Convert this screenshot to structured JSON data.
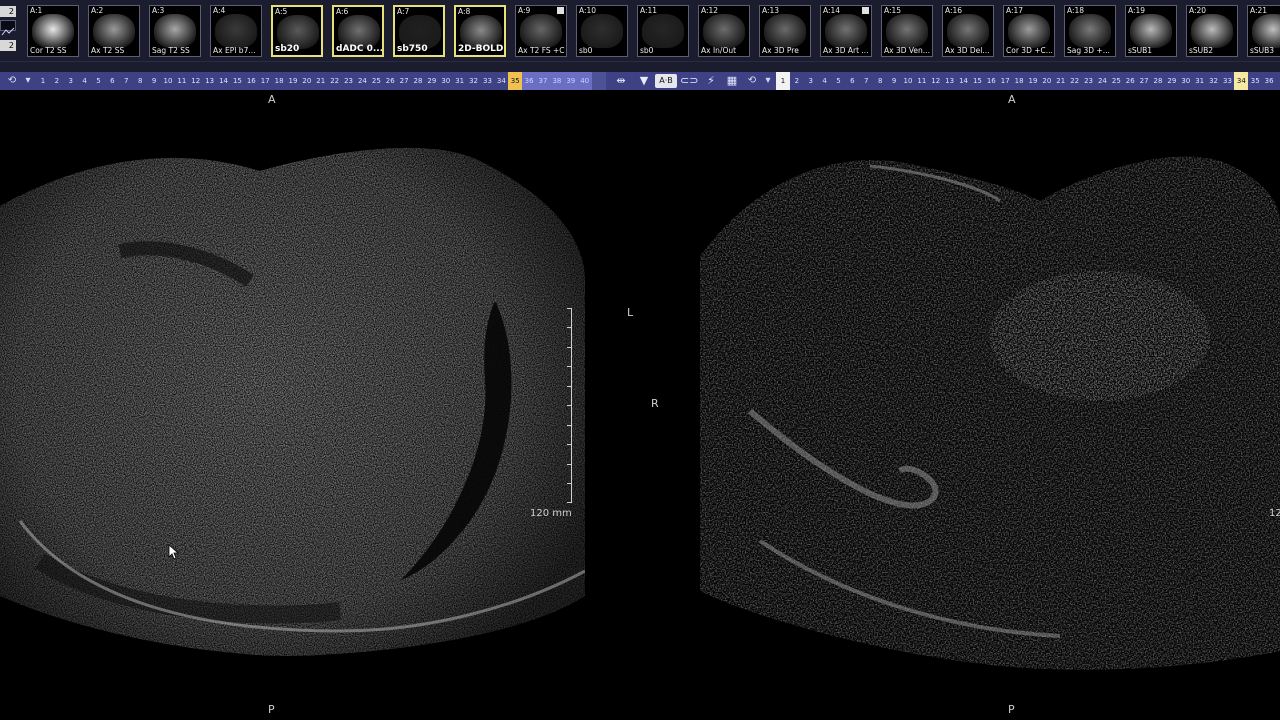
{
  "strip_left": {
    "top": "2",
    "bottom": "2"
  },
  "thumbnails": [
    {
      "id": "A:1",
      "label": "Cor T2 SS",
      "selected": false,
      "flag": false,
      "tone": "#e8e8e8"
    },
    {
      "id": "A:2",
      "label": "Ax T2 SS",
      "selected": false,
      "flag": false,
      "tone": "#9a9a9a"
    },
    {
      "id": "A:3",
      "label": "Sag T2 SS",
      "selected": false,
      "flag": false,
      "tone": "#a8a8a8"
    },
    {
      "id": "A:4",
      "label": "Ax EPI b7...",
      "selected": false,
      "flag": false,
      "tone": "#3a3a3a"
    },
    {
      "id": "A:5",
      "label": "sb20",
      "selected": true,
      "flag": false,
      "tone": "#5a5a5a"
    },
    {
      "id": "A:6",
      "label": "dADC 0...",
      "selected": true,
      "flag": false,
      "tone": "#707070"
    },
    {
      "id": "A:7",
      "label": "sb750",
      "selected": true,
      "flag": false,
      "tone": "#202020"
    },
    {
      "id": "A:8",
      "label": "2D-BOLD",
      "selected": true,
      "flag": false,
      "tone": "#8a8a8a"
    },
    {
      "id": "A:9",
      "label": "Ax T2 FS +C",
      "selected": false,
      "flag": true,
      "tone": "#666666"
    },
    {
      "id": "A:10",
      "label": "sb0",
      "selected": false,
      "flag": false,
      "tone": "#2e2e2e"
    },
    {
      "id": "A:11",
      "label": "sb0",
      "selected": false,
      "flag": false,
      "tone": "#252525"
    },
    {
      "id": "A:12",
      "label": "Ax In/Out",
      "selected": false,
      "flag": false,
      "tone": "#6c6c6c"
    },
    {
      "id": "A:13",
      "label": "Ax 3D Pre",
      "selected": false,
      "flag": false,
      "tone": "#6a6a6a"
    },
    {
      "id": "A:14",
      "label": "Ax 3D Art ...",
      "selected": false,
      "flag": true,
      "tone": "#727272"
    },
    {
      "id": "A:15",
      "label": "Ax 3D Ven...",
      "selected": false,
      "flag": false,
      "tone": "#747474"
    },
    {
      "id": "A:16",
      "label": "Ax 3D Del...",
      "selected": false,
      "flag": false,
      "tone": "#767676"
    },
    {
      "id": "A:17",
      "label": "Cor 3D +C...",
      "selected": false,
      "flag": false,
      "tone": "#9c9c9c"
    },
    {
      "id": "A:18",
      "label": "Sag 3D +...",
      "selected": false,
      "flag": false,
      "tone": "#7a7a7a"
    },
    {
      "id": "A:19",
      "label": "sSUB1",
      "selected": false,
      "flag": false,
      "tone": "#b8b8b8"
    },
    {
      "id": "A:20",
      "label": "sSUB2",
      "selected": false,
      "flag": false,
      "tone": "#bcbcbc"
    },
    {
      "id": "A:21",
      "label": "sSUB3",
      "selected": false,
      "flag": false,
      "tone": "#c0c0c0"
    }
  ],
  "toolbar": {
    "left_slices": [
      "1",
      "2",
      "3",
      "4",
      "5",
      "6",
      "7",
      "8",
      "9",
      "10",
      "11",
      "12",
      "13",
      "14",
      "15",
      "16",
      "17",
      "18",
      "19",
      "20",
      "21",
      "22",
      "23",
      "24",
      "25",
      "26",
      "27",
      "28",
      "29",
      "30",
      "31",
      "32",
      "33",
      "34",
      "35",
      "36",
      "37",
      "38",
      "39",
      "40"
    ],
    "left_highlight": "35",
    "ab_label": "A·B",
    "right_slices": [
      "1",
      "2",
      "3",
      "4",
      "5",
      "6",
      "7",
      "8",
      "9",
      "10",
      "11",
      "12",
      "13",
      "14",
      "15",
      "16",
      "17",
      "18",
      "19",
      "20",
      "21",
      "22",
      "23",
      "24",
      "25",
      "26",
      "27",
      "28",
      "29",
      "30",
      "31",
      "32",
      "33",
      "34",
      "35",
      "36"
    ],
    "right_current": "1",
    "right_highlight": "34"
  },
  "left_viewport": {
    "top_label": "A",
    "bottom_label": "P",
    "left_orient": "L",
    "scale_text": "120 mm"
  },
  "right_viewport": {
    "top_label": "A",
    "bottom_label": "P",
    "right_orient": "R",
    "scale_text": "12"
  },
  "colors": {
    "toolbar_bg": "#3e4285",
    "strip_bg": "#1b1c2e",
    "selected_border": "#e6e07a",
    "slice_highlight": "#f0c050"
  }
}
